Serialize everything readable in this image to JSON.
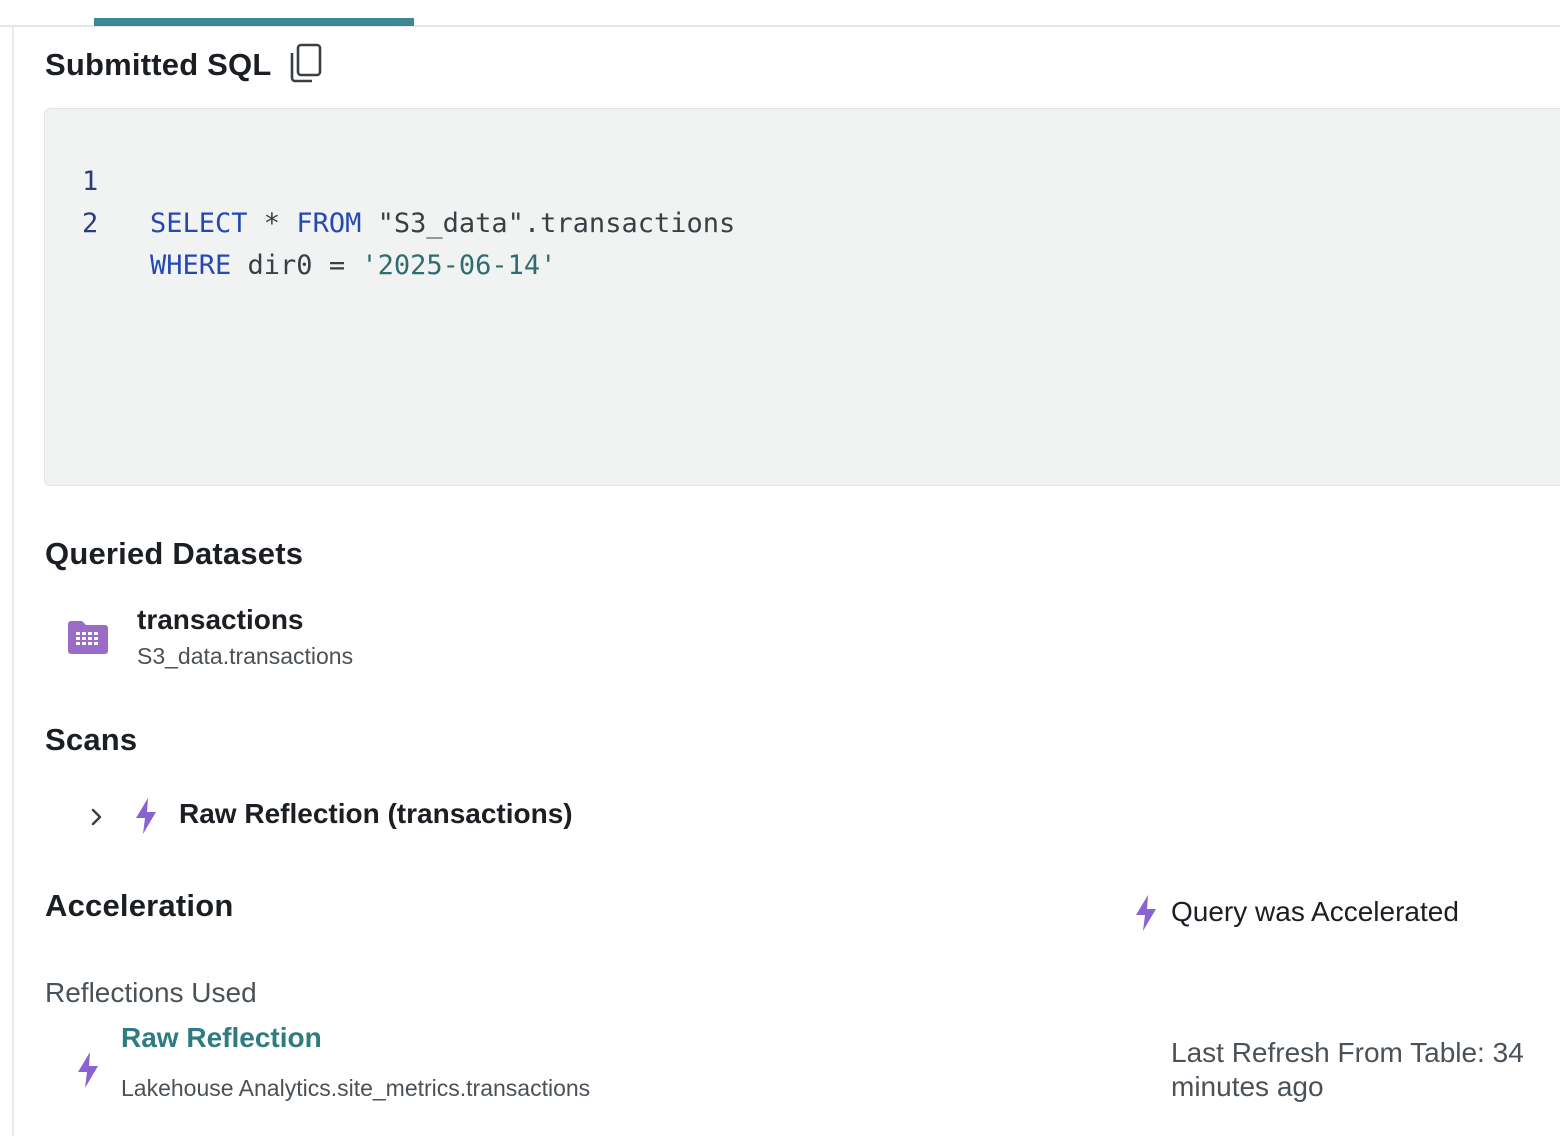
{
  "submitted_sql": {
    "title": "Submitted SQL",
    "copy_icon": "copy-icon",
    "lines": [
      {
        "number": "1",
        "tokens": [
          {
            "type": "kw",
            "text": "SELECT"
          },
          {
            "type": "plain",
            "text": " * "
          },
          {
            "type": "kw",
            "text": "FROM"
          },
          {
            "type": "plain",
            "text": " \"S3_data\".transactions"
          }
        ]
      },
      {
        "number": "2",
        "tokens": [
          {
            "type": "kw",
            "text": "WHERE"
          },
          {
            "type": "plain",
            "text": " dir0 = "
          },
          {
            "type": "str",
            "text": "'2025-06-14'"
          }
        ]
      }
    ]
  },
  "queried_datasets": {
    "title": "Queried Datasets",
    "items": [
      {
        "name": "transactions",
        "path": "S3_data.transactions",
        "icon": "table-dataset-icon"
      }
    ]
  },
  "scans": {
    "title": "Scans",
    "items": [
      {
        "label": "Raw Reflection (transactions)",
        "icon": "lightning-bolt-icon"
      }
    ]
  },
  "acceleration": {
    "title": "Acceleration",
    "status": "Query was Accelerated",
    "reflections_heading": "Reflections Used",
    "reflections": [
      {
        "name": "Raw Reflection",
        "path": "Lakehouse Analytics.site_metrics.transactions",
        "refresh": "Last Refresh From Table: 34 minutes ago"
      }
    ]
  },
  "colors": {
    "accent_teal": "#3e8795",
    "bolt_purple": "#8a63d2",
    "dataset_icon_purple": "#9a6cc8",
    "link_teal": "#2e7b80"
  }
}
